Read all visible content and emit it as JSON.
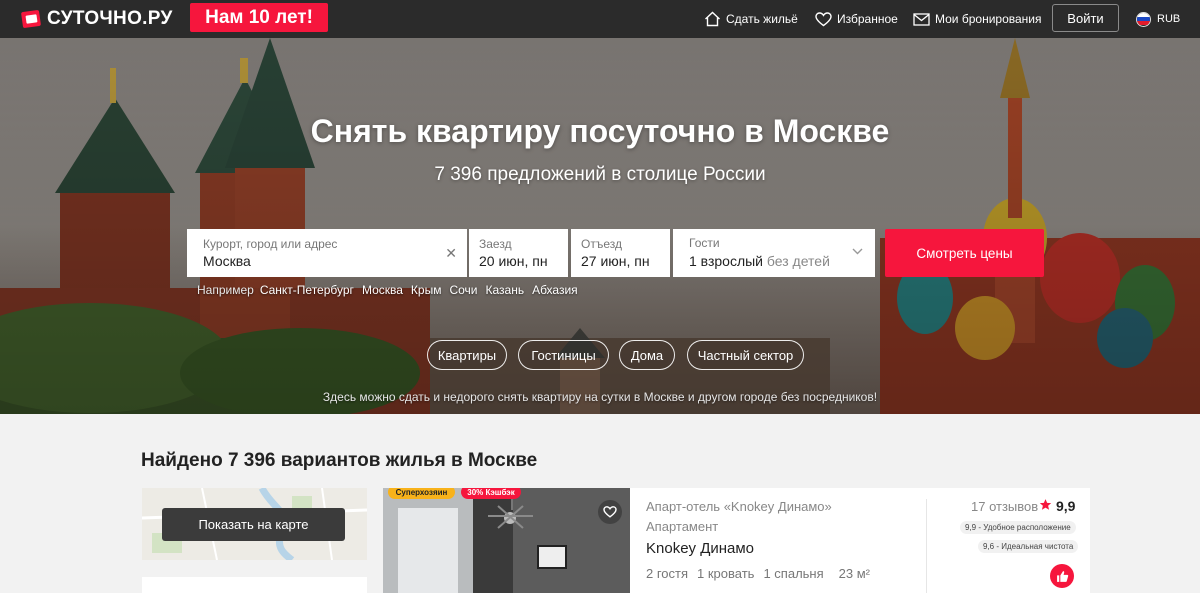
{
  "header": {
    "logo_text": "СУТОЧНО.РУ",
    "anniversary": "Нам 10 лет!",
    "nav": [
      {
        "label": "Сдать жильё",
        "icon": "house-icon"
      },
      {
        "label": "Избранное",
        "icon": "heart-icon"
      },
      {
        "label": "Мои бронирования",
        "icon": "mail-icon"
      }
    ],
    "login_label": "Войти",
    "currency": "RUB"
  },
  "hero": {
    "title": "Снять квартиру посуточно в Москве",
    "subtitle": "7 396 предложений в столице России",
    "search": {
      "city_label": "Курорт, город или адрес",
      "city_value": "Москва",
      "checkin_label": "Заезд",
      "checkin_value": "20 июн, пн",
      "checkout_label": "Отъезд",
      "checkout_value": "27 июн, пн",
      "guests_label": "Гости",
      "guests_value": "1 взрослый",
      "guests_suffix": "без детей",
      "cta": "Смотреть цены"
    },
    "examples_label": "Например",
    "examples": [
      "Санкт-Петербург",
      "Москва",
      "Крым",
      "Сочи",
      "Казань",
      "Абхазия"
    ],
    "chips": [
      "Квартиры",
      "Гостиницы",
      "Дома",
      "Частный сектор"
    ],
    "note": "Здесь можно сдать и недорого снять квартиру на сутки в Москве и другом городе без посредников!"
  },
  "results": {
    "heading": "Найдено 7 396 вариантов жилья в Москве",
    "map_button": "Показать на карте",
    "card": {
      "badge_host": "Суперхозяин",
      "badge_cashback": "30% Кэшбэк",
      "type": "Апарт-отель «Knokey Динамо»",
      "kind": "Апартамент",
      "name": "Knokey Динамо",
      "guests": "2 гостя",
      "beds": "1 кровать",
      "bedrooms": "1 спальня",
      "area": "23 м²",
      "reviews": "17 отзывов",
      "score": "9,9",
      "tags": [
        "9,9 - Удобное расположение",
        "9,6 - Идеальная чистота"
      ]
    }
  },
  "colors": {
    "brand": "#f6163d",
    "topbar": "#2b2b2b",
    "superhost": "#f8b21a"
  }
}
